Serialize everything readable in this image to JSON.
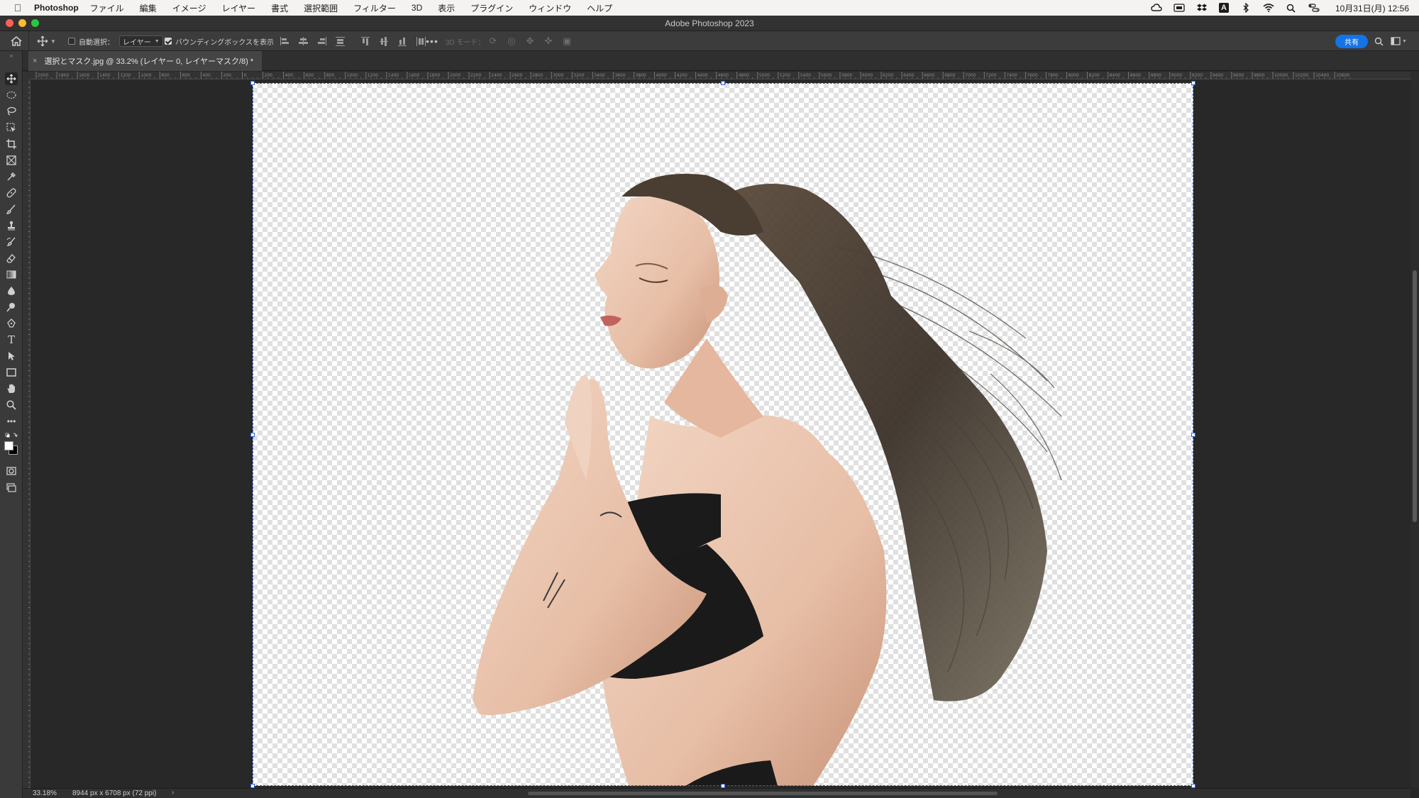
{
  "menubar": {
    "app_name": "Photoshop",
    "items": [
      "ファイル",
      "編集",
      "イメージ",
      "レイヤー",
      "書式",
      "選択範囲",
      "フィルター",
      "3D",
      "表示",
      "プラグイン",
      "ウィンドウ",
      "ヘルプ"
    ],
    "status_icons": [
      "creative-cloud-icon",
      "display-icon",
      "dropbox-icon",
      "input-method-icon",
      "bluetooth-icon",
      "wifi-icon",
      "search-icon",
      "control-center-icon"
    ],
    "input_method_label": "A",
    "clock": "10月31日(月)  12:56"
  },
  "window": {
    "title": "Adobe Photoshop 2023"
  },
  "options_bar": {
    "auto_select_label": "自動選択：",
    "auto_select_checked": false,
    "auto_select_target": "レイヤー",
    "bounding_box_label": "バウンディングボックスを表示",
    "bounding_box_checked": true,
    "mode_3d_label": "3D モード：",
    "share_label": "共有"
  },
  "document": {
    "tab_title": "選択とマスク.jpg @ 33.2% (レイヤー 0, レイヤーマスク/8) *"
  },
  "ruler": {
    "top_labels": [
      "2000",
      "1800",
      "1600",
      "1400",
      "1200",
      "1000",
      "800",
      "600",
      "400",
      "200",
      "0",
      "200",
      "400",
      "600",
      "800",
      "1000",
      "1200",
      "1400",
      "1600",
      "1800",
      "2000",
      "2200",
      "2400",
      "2600",
      "2800",
      "3000",
      "3200",
      "3400",
      "3600",
      "3800",
      "4000",
      "4200",
      "4400",
      "4600",
      "4800",
      "5000",
      "5200",
      "5400",
      "5600",
      "5800",
      "6000",
      "6200",
      "6400",
      "6600",
      "6800",
      "7000",
      "7200",
      "7400",
      "7600",
      "7800",
      "8000",
      "8200",
      "8400",
      "8600",
      "8800",
      "9000",
      "9200",
      "9400",
      "9600",
      "9800",
      "10000",
      "10200",
      "10400",
      "10600"
    ]
  },
  "status_bar": {
    "zoom": "33.18%",
    "doc_info": "8944 px x 6708 px (72 ppi)"
  },
  "colors": {
    "accent": "#1473e6",
    "selection_line": "#2b5fd9"
  }
}
